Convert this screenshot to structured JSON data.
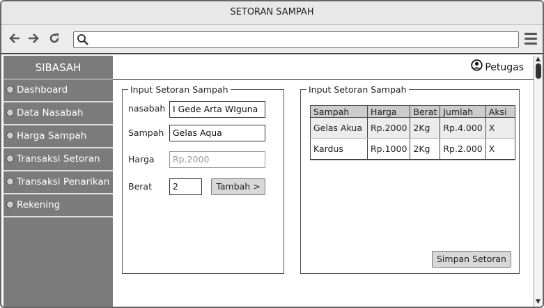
{
  "window": {
    "title": "SETORAN SAMPAH"
  },
  "toolbar": {
    "back_icon": "arrow-left-icon",
    "forward_icon": "arrow-right-icon",
    "reload_icon": "reload-icon",
    "address_value": "",
    "menu_icon": "hamburger-icon"
  },
  "sidebar": {
    "brand": "SIBASAH",
    "items": [
      {
        "label": "Dashboard"
      },
      {
        "label": "Data Nasabah"
      },
      {
        "label": "Harga Sampah"
      },
      {
        "label": "Transaksi Setoran"
      },
      {
        "label": "Transaksi Penarikan"
      },
      {
        "label": "Rekening"
      }
    ]
  },
  "header": {
    "user_label": "Petugas"
  },
  "form": {
    "legend": "Input Setoran Sampah",
    "nasabah_label": "nasabah",
    "nasabah_value": "I Gede Arta WIguna",
    "sampah_label": "Sampah",
    "sampah_value": "Gelas Aqua",
    "harga_label": "Harga",
    "harga_placeholder": "Rp.2000",
    "berat_label": "Berat",
    "berat_value": "2",
    "tambah_label": "Tambah >"
  },
  "list": {
    "legend": "Input Setoran Sampah",
    "columns": [
      "Sampah",
      "Harga",
      "Berat",
      "Jumlah",
      "Aksi"
    ],
    "rows": [
      [
        "Gelas Akua",
        "Rp.2000",
        "2Kg",
        "Rp.4.000",
        "X"
      ],
      [
        "Kardus",
        "Rp.1000",
        "2Kg",
        "Rp.2.000",
        "X"
      ]
    ],
    "simpan_label": "Simpan Setoran"
  }
}
